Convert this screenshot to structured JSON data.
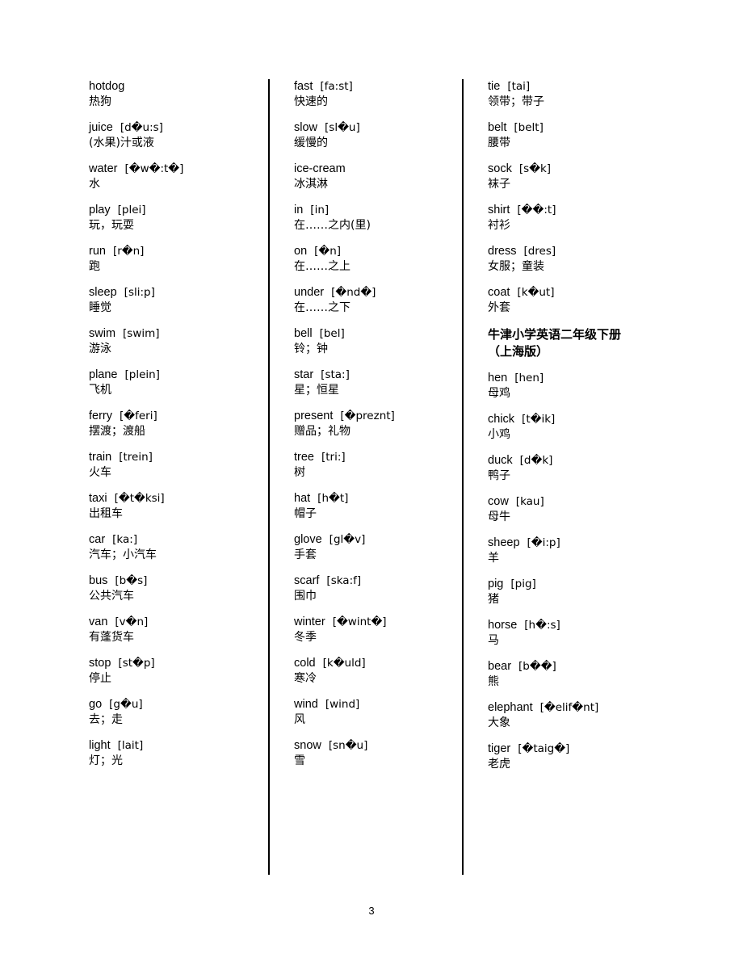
{
  "page": {
    "number": "3"
  },
  "columns": [
    {
      "id": "column-1",
      "entries": [
        {
          "word": "hotdog",
          "phonetic": "",
          "meaning": "热狗"
        },
        {
          "word": "juice",
          "phonetic": "[d�u:s]",
          "meaning": "(水果)汁或液"
        },
        {
          "word": "water",
          "phonetic": "[�w�:t�]",
          "meaning": "水"
        },
        {
          "word": "play",
          "phonetic": "[plei]",
          "meaning": "玩，玩耍"
        },
        {
          "word": "run",
          "phonetic": "[r�n]",
          "meaning": "跑"
        },
        {
          "word": "sleep",
          "phonetic": "[sli:p]",
          "meaning": "睡觉"
        },
        {
          "word": "swim",
          "phonetic": "[swim]",
          "meaning": "游泳"
        },
        {
          "word": "plane",
          "phonetic": "[plein]",
          "meaning": "飞机"
        },
        {
          "word": "ferry",
          "phonetic": "[�feri]",
          "meaning": "摆渡；渡船"
        },
        {
          "word": "train",
          "phonetic": "[trein]",
          "meaning": "火车"
        },
        {
          "word": "taxi",
          "phonetic": "[�t�ksi]",
          "meaning": "出租车"
        },
        {
          "word": "car",
          "phonetic": "[ka:]",
          "meaning": "汽车；小汽车"
        },
        {
          "word": "bus",
          "phonetic": "[b�s]",
          "meaning": "公共汽车"
        },
        {
          "word": "van",
          "phonetic": "[v�n]",
          "meaning": "有蓬货车"
        },
        {
          "word": "stop",
          "phonetic": "[st�p]",
          "meaning": "停止"
        },
        {
          "word": "go",
          "phonetic": "[g�u]",
          "meaning": "去；走"
        },
        {
          "word": "light",
          "phonetic": "[lait]",
          "meaning": "灯；光"
        }
      ]
    },
    {
      "id": "column-2",
      "entries": [
        {
          "word": "fast",
          "phonetic": "[fa:st]",
          "meaning": "快速的"
        },
        {
          "word": "slow",
          "phonetic": "[sl�u]",
          "meaning": "缓慢的"
        },
        {
          "word": "ice-cream",
          "phonetic": "",
          "meaning": "冰淇淋"
        },
        {
          "word": "in",
          "phonetic": "[in]",
          "meaning": "在……之内(里)"
        },
        {
          "word": "on",
          "phonetic": "[�n]",
          "meaning": "在……之上"
        },
        {
          "word": "under",
          "phonetic": "[�nd�]",
          "meaning": "在……之下"
        },
        {
          "word": "bell",
          "phonetic": "[bel]",
          "meaning": "铃；钟"
        },
        {
          "word": "star",
          "phonetic": "[sta:]",
          "meaning": "星；恒星"
        },
        {
          "word": "present",
          "phonetic": "[�preznt]",
          "meaning": "赠品；礼物"
        },
        {
          "word": "tree",
          "phonetic": "[tri:]",
          "meaning": "树"
        },
        {
          "word": "hat",
          "phonetic": "[h�t]",
          "meaning": "帽子"
        },
        {
          "word": "glove",
          "phonetic": "[gl�v]",
          "meaning": "手套"
        },
        {
          "word": "scarf",
          "phonetic": "[ska:f]",
          "meaning": "围巾"
        },
        {
          "word": "winter",
          "phonetic": "[�wint�]",
          "meaning": "冬季"
        },
        {
          "word": "cold",
          "phonetic": "[k�uld]",
          "meaning": "寒冷"
        },
        {
          "word": "wind",
          "phonetic": "[wind]",
          "meaning": "风"
        },
        {
          "word": "snow",
          "phonetic": "[sn�u]",
          "meaning": "雪"
        }
      ]
    },
    {
      "id": "column-3",
      "entries": [
        {
          "word": "tie",
          "phonetic": "[tai]",
          "meaning": "领带；带子"
        },
        {
          "word": "belt",
          "phonetic": "[belt]",
          "meaning": "腰带"
        },
        {
          "word": "sock",
          "phonetic": "[s�k]",
          "meaning": "袜子"
        },
        {
          "word": "shirt",
          "phonetic": "[��:t]",
          "meaning": "衬衫"
        },
        {
          "word": "dress",
          "phonetic": "[dres]",
          "meaning": "女服；童装"
        },
        {
          "word": "coat",
          "phonetic": "[k�ut]",
          "meaning": "外套"
        },
        {
          "heading": [
            "牛津小学英语二年级下册",
            "（上海版）"
          ]
        },
        {
          "word": "hen",
          "phonetic": "[hen]",
          "meaning": "母鸡"
        },
        {
          "word": "chick",
          "phonetic": "[t�ik]",
          "meaning": "小鸡"
        },
        {
          "word": "duck",
          "phonetic": "[d�k]",
          "meaning": "鸭子"
        },
        {
          "word": "cow",
          "phonetic": "[kau]",
          "meaning": "母牛"
        },
        {
          "word": "sheep",
          "phonetic": "[�i:p]",
          "meaning": "羊"
        },
        {
          "word": "pig",
          "phonetic": "[pig]",
          "meaning": "猪"
        },
        {
          "word": "horse",
          "phonetic": "[h�:s]",
          "meaning": "马"
        },
        {
          "word": "bear",
          "phonetic": "[b��]",
          "meaning": "熊"
        },
        {
          "word": "elephant",
          "phonetic": "[�elif�nt]",
          "meaning": "大象"
        },
        {
          "word": "tiger",
          "phonetic": "[�taig�]",
          "meaning": "老虎"
        }
      ]
    }
  ]
}
